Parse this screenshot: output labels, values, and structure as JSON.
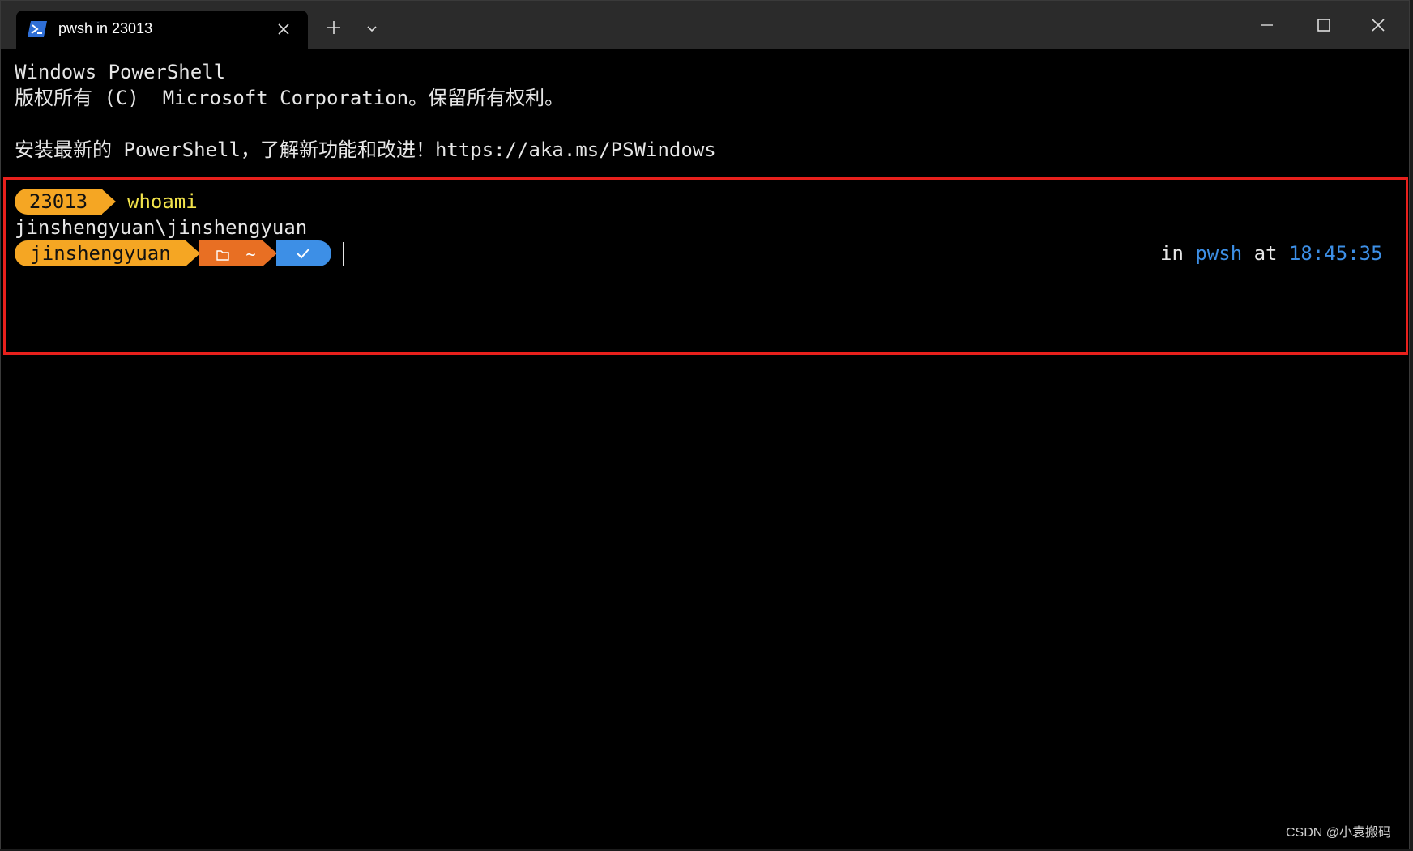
{
  "tab": {
    "title": "pwsh in 23013",
    "icon": "powershell-icon"
  },
  "titlebar": {
    "new_tab_icon": "plus-icon",
    "dropdown_icon": "chevron-down-icon",
    "minimize_icon": "minimize-icon",
    "maximize_icon": "maximize-icon",
    "close_icon": "close-icon"
  },
  "terminal": {
    "header_line1": "Windows PowerShell",
    "header_line2": "版权所有 (C)  Microsoft Corporation。保留所有权利。",
    "header_line3": "安装最新的 PowerShell，了解新功能和改进！https://aka.ms/PSWindows",
    "prompt1": {
      "segment": "23013",
      "command": "whoami"
    },
    "output1": "jinshengyuan\\jinshengyuan",
    "prompt2": {
      "user_segment": "jinshengyuan",
      "path_segment": "~",
      "path_icon": "folder-icon",
      "status_icon": "check-icon",
      "right_in": "in",
      "right_shell": "pwsh",
      "right_at": "at",
      "right_time": "18:45:35"
    }
  },
  "watermark": "CSDN @小袁搬码",
  "colors": {
    "segment_yellow": "#f5a623",
    "segment_orange": "#e86f23",
    "segment_blue": "#3d8fe6",
    "command_yellow": "#f2e34b",
    "accent_blue": "#3d8fe6",
    "highlight_red": "#e8201c"
  }
}
